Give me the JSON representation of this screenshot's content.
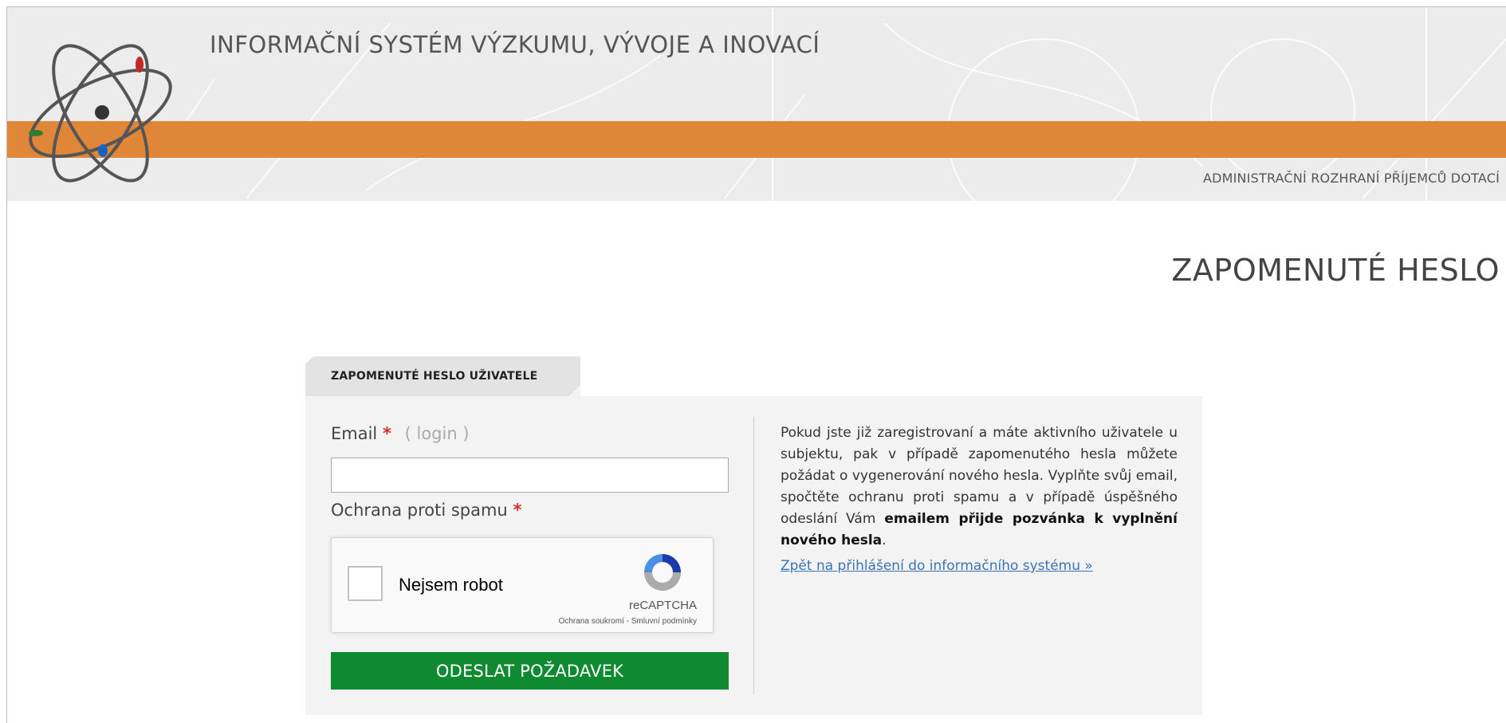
{
  "header": {
    "site_title": "INFORMAČNÍ SYSTÉM VÝZKUMU, VÝVOJE A INOVACÍ",
    "admin_label": "ADMINISTRAČNÍ ROZHRANÍ PŘÍJEMCŮ DOTACÍ",
    "accent_color": "#e08638"
  },
  "page": {
    "heading": "ZAPOMENUTÉ HESLO"
  },
  "form": {
    "tab_label": "ZAPOMENUTÉ HESLO UŽIVATELE",
    "email_label": "Email",
    "required_mark": "*",
    "email_hint": "( login )",
    "email_value": "",
    "spam_label": "Ochrana proti spamu",
    "captcha": {
      "checkbox_label": "Nejsem robot",
      "brand": "reCAPTCHA",
      "privacy": "Ochrana soukromí",
      "separator": " - ",
      "terms": "Smluvní podmínky"
    },
    "submit_label": "ODESLAT POŽADAVEK",
    "submit_color": "#0f8a30"
  },
  "info": {
    "text_before": "Pokud jste již zaregistrovaní a máte aktivního uživatele u subjektu, pak v případě zapomenutého hesla můžete požádat o vygenerování nového hesla. Vyplňte svůj email, spočtěte ochranu proti spamu a v případě úspěšného odeslání Vám ",
    "text_bold": "emailem přijde pozvánka k vyplnění nového hesla",
    "text_after": ".",
    "back_link": "Zpět na přihlášení do informačního systému »"
  }
}
